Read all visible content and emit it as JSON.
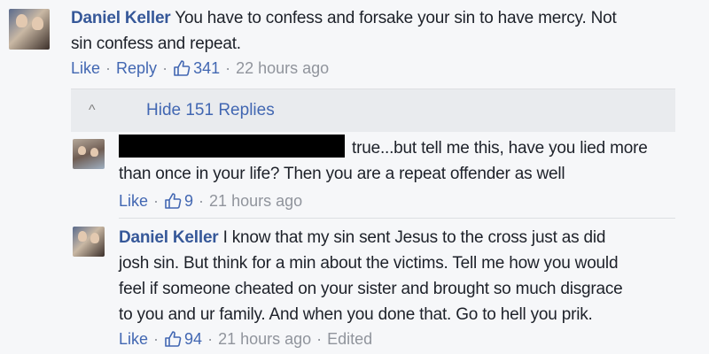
{
  "comment": {
    "author": "Daniel Keller",
    "text_line1": " You have to confess and forsake your sin to have mercy. Not",
    "text_line2": "sin confess and repeat.",
    "like_label": "Like",
    "reply_label": "Reply",
    "like_count": "341",
    "timestamp": "22 hours ago"
  },
  "replies_toggle": {
    "chevron": "^",
    "label": "Hide 151 Replies"
  },
  "reply1": {
    "text_line1": "true...but tell me this, have you lied more",
    "text_line2": "than once in your life? Then you are a repeat offender as well",
    "like_label": "Like",
    "like_count": "9",
    "timestamp": "21 hours ago"
  },
  "reply2": {
    "author": "Daniel Keller",
    "text_line1": " I know that my sin sent Jesus to the cross just as did",
    "text_line2": "josh sin. But think for a min about the victims. Tell me how you would",
    "text_line3": "feel if someone cheated on your sister and brought so much disgrace",
    "text_line4": "to you and ur family. And when you done that. Go to hell you prik.",
    "like_label": "Like",
    "like_count": "94",
    "timestamp": "21 hours ago",
    "edited_label": "Edited"
  },
  "colors": {
    "background": "#f6f7f9",
    "link": "#4267b2",
    "author": "#365899",
    "meta": "#90949c",
    "replies_bar": "#e9ebee"
  }
}
